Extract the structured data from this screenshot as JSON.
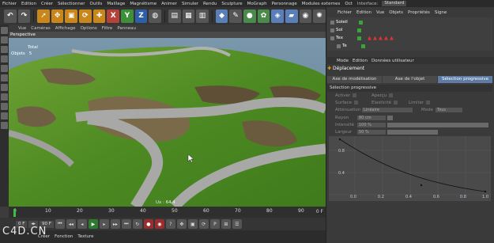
{
  "menubar": {
    "items": [
      "Fichier",
      "Edition",
      "Créer",
      "Sélectionner",
      "Outils",
      "Maillage",
      "Magnétisme",
      "Animer",
      "Simuler",
      "Rendu",
      "Sculpture",
      "MoGraph",
      "Personnage",
      "Modules externes",
      "Oct"
    ],
    "interface_label": "Interface:",
    "interface_value": "Standard"
  },
  "toolbar": {
    "icons": [
      "undo-icon",
      "redo-icon",
      "select-arrow-icon",
      "move-icon",
      "scale-icon",
      "rotate-icon",
      "add-icon",
      "x-axis-icon",
      "y-axis-icon",
      "z-axis-icon",
      "world-icon",
      "render-region-icon",
      "render-icon",
      "render-settings-icon",
      "cube-icon",
      "spline-pen-icon",
      "nurbs-icon",
      "array-icon",
      "deformer-icon",
      "floor-icon",
      "camera-icon",
      "light-icon"
    ],
    "axis_labels": {
      "x": "X",
      "y": "Y",
      "z": "Z"
    }
  },
  "viewport": {
    "menu": [
      "Vue",
      "Caméras",
      "Affichage",
      "Options",
      "Filtre",
      "Panneau"
    ],
    "title": "Perspective",
    "stats_header": "Total",
    "stats_label": "Objets",
    "stats_value": "5",
    "overlay_text": "Ux : 64.4"
  },
  "timeline": {
    "ticks": [
      "0",
      "10",
      "20",
      "30",
      "40",
      "50",
      "60",
      "70",
      "80",
      "90"
    ],
    "end_label": "0 F"
  },
  "transport": {
    "start_field": "0 F",
    "end_field": "90 F"
  },
  "bottom_tabs": [
    "Créer",
    "Fonction",
    "Texture"
  ],
  "watermark": "C4D.CN",
  "object_manager": {
    "menu": [
      "Fichier",
      "Edition",
      "Vue",
      "Objets",
      "Propriétés",
      "Signe"
    ],
    "objects": [
      "Soleil",
      "Sol",
      "Tex",
      "Te"
    ]
  },
  "attribute_manager": {
    "menu": [
      "Mode",
      "Edition",
      "Données utilisateur"
    ],
    "title": "Déplacement",
    "tabs": [
      "Axe de modélisation",
      "Axe de l'objet",
      "Sélection progressive"
    ],
    "section": "Sélection progressive",
    "props": {
      "activer": "Activer",
      "apercu": "Aperçu",
      "surface": "Surface",
      "elasticite": "Elasticité",
      "limiter": "Limiter",
      "attenuation_label": "Atténuation",
      "attenuation_value": "Linéaire",
      "mode_label": "Mode",
      "mode_value": "Tous",
      "rayon_label": "Rayon",
      "rayon_value": "80 cm",
      "intensite_label": "Intensité",
      "intensite_value": "100 %",
      "largeur_label": "Largeur",
      "largeur_value": "50 %"
    },
    "graph": {
      "y_labels": [
        "0.8",
        "0.4"
      ],
      "x_labels": [
        "0.0",
        "0.2",
        "0.4",
        "0.6",
        "0.8",
        "1.0"
      ]
    }
  },
  "colors": {
    "accent_tab": "#5d7ba5",
    "play_green": "#2e7a2e",
    "record_red": "#9a2d2d",
    "toolbar_orange": "#c8861b"
  }
}
